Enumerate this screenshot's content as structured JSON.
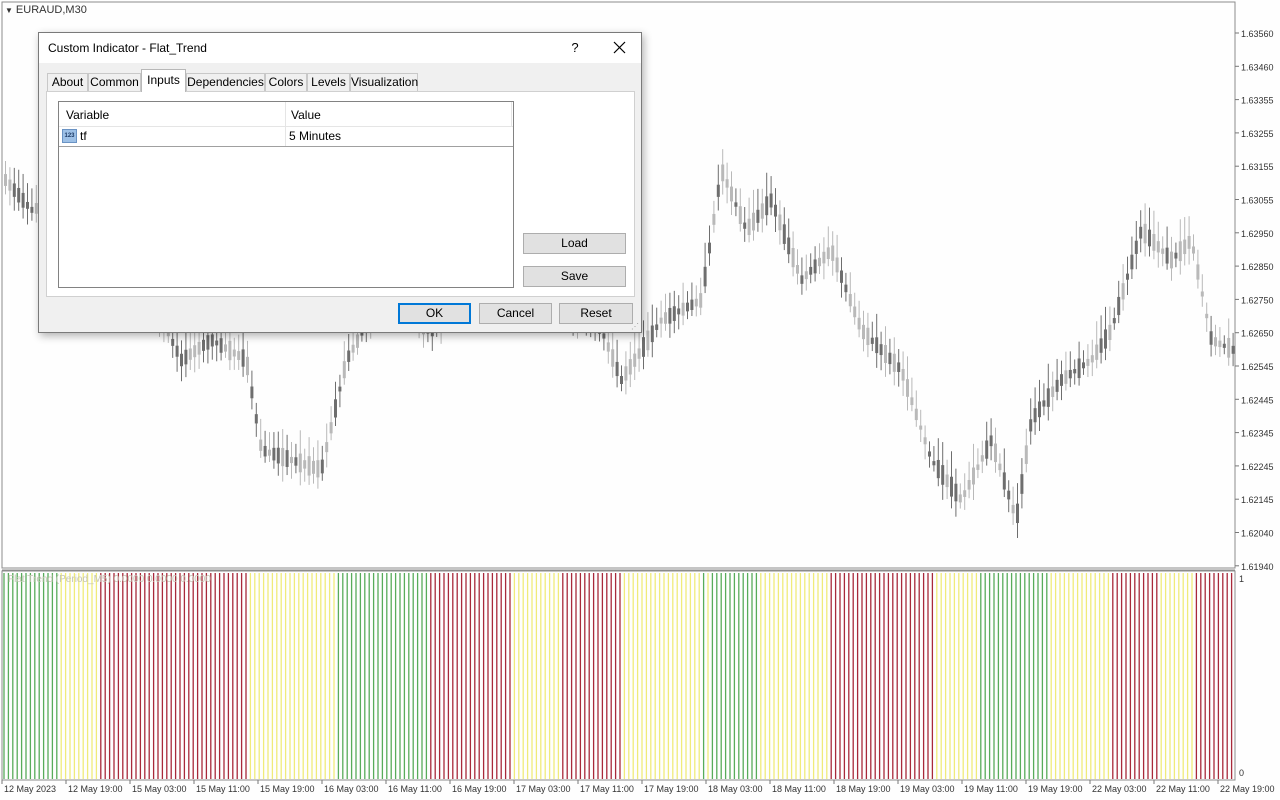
{
  "chart": {
    "symbol": "EURAUD,M30",
    "indicator_label": "Flat Trend (Period_M5) 0.0000 0.0000 0.0000",
    "price_axis": [
      "1.63560",
      "1.63460",
      "1.63355",
      "1.63255",
      "1.63155",
      "1.63055",
      "1.62950",
      "1.62850",
      "1.62750",
      "1.62650",
      "1.62545",
      "1.62445",
      "1.62345",
      "1.62245",
      "1.62145",
      "1.62040",
      "1.61940"
    ],
    "sub_axis": [
      "1",
      "0"
    ],
    "time_axis": [
      "12 May 2023",
      "12 May 19:00",
      "15 May 03:00",
      "15 May 11:00",
      "15 May 19:00",
      "16 May 03:00",
      "16 May 11:00",
      "16 May 19:00",
      "17 May 03:00",
      "17 May 11:00",
      "17 May 19:00",
      "18 May 03:00",
      "18 May 11:00",
      "18 May 19:00",
      "19 May 03:00",
      "19 May 11:00",
      "19 May 19:00",
      "22 May 03:00",
      "22 May 11:00",
      "22 May 19:00"
    ],
    "colors": {
      "bull": "#b9b9b9",
      "bear": "#6e6e6e",
      "trend_red": "#a8293a",
      "trend_green": "#58ac5a",
      "trend_yellow": "#f0eb7a",
      "trend_blue": "#55a6d8"
    }
  },
  "dialog": {
    "title": "Custom Indicator - Flat_Trend",
    "help_icon": "?",
    "tabs": [
      "About",
      "Common",
      "Inputs",
      "Dependencies",
      "Colors",
      "Levels",
      "Visualization"
    ],
    "active_tab": "Inputs",
    "table": {
      "headers": {
        "variable": "Variable",
        "value": "Value"
      },
      "rows": [
        {
          "icon": "123",
          "name": "tf",
          "value": "5 Minutes"
        }
      ]
    },
    "buttons": {
      "load": "Load",
      "save": "Save",
      "ok": "OK",
      "cancel": "Cancel",
      "reset": "Reset"
    }
  }
}
